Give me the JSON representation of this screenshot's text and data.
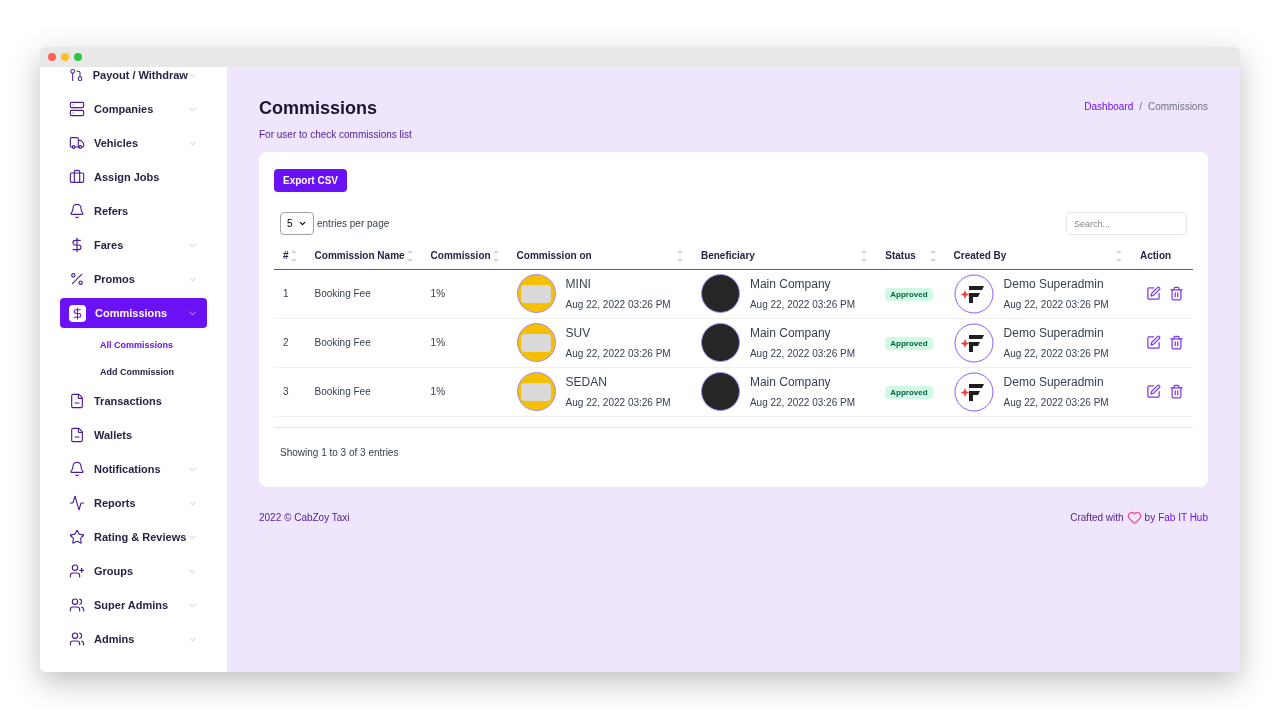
{
  "sidebar": {
    "items": [
      {
        "label": "Payout / Withdraw",
        "expandable": true,
        "selected": false
      },
      {
        "label": "Companies",
        "expandable": true,
        "selected": false
      },
      {
        "label": "Vehicles",
        "expandable": true,
        "selected": false
      },
      {
        "label": "Assign Jobs",
        "expandable": false,
        "selected": false
      },
      {
        "label": "Refers",
        "expandable": false,
        "selected": false
      },
      {
        "label": "Fares",
        "expandable": true,
        "selected": false
      },
      {
        "label": "Promos",
        "expandable": true,
        "selected": false
      },
      {
        "label": "Commissions",
        "expandable": true,
        "selected": true,
        "children": [
          {
            "label": "All Commissions",
            "selected": true
          },
          {
            "label": "Add Commission",
            "selected": false
          }
        ]
      },
      {
        "label": "Transactions",
        "expandable": false,
        "selected": false
      },
      {
        "label": "Wallets",
        "expandable": false,
        "selected": false
      },
      {
        "label": "Notifications",
        "expandable": true,
        "selected": false
      },
      {
        "label": "Reports",
        "expandable": true,
        "selected": false
      },
      {
        "label": "Rating & Reviews",
        "expandable": true,
        "selected": false
      },
      {
        "label": "Groups",
        "expandable": true,
        "selected": false
      },
      {
        "label": "Super Admins",
        "expandable": true,
        "selected": false
      },
      {
        "label": "Admins",
        "expandable": true,
        "selected": false
      }
    ]
  },
  "page": {
    "title": "Commissions",
    "subtitle": "For user to check commissions list",
    "breadcrumb_separator": "/",
    "breadcrumb": [
      {
        "label": "Dashboard",
        "link": true
      },
      {
        "label": "Commissions",
        "link": false
      }
    ]
  },
  "toolbar": {
    "export_button": "Export CSV",
    "page_size": "5",
    "page_size_label": "entries per page",
    "search": {
      "placeholder": "Search..."
    }
  },
  "table": {
    "columns": [
      {
        "label": "#",
        "sortable": true
      },
      {
        "label": "Commission Name",
        "sortable": true
      },
      {
        "label": "Commission",
        "sortable": true
      },
      {
        "label": "Commission on",
        "sortable": true
      },
      {
        "label": "Beneficiary",
        "sortable": true
      },
      {
        "label": "Status",
        "sortable": true
      },
      {
        "label": "Created By",
        "sortable": true
      },
      {
        "label": "Action",
        "sortable": false
      }
    ],
    "rows": [
      {
        "no": "1",
        "name": "Booking Fee",
        "commission": "1%",
        "vehicle": "MINI",
        "vehicle_date": "Aug 22, 2022 03:26 PM",
        "beneficiary": "Main Company",
        "beneficiary_date": "Aug 22, 2022 03:26 PM",
        "status": "Approved",
        "created_by": "Demo Superadmin",
        "created_date": "Aug 22, 2022 03:26 PM"
      },
      {
        "no": "2",
        "name": "Booking Fee",
        "commission": "1%",
        "vehicle": "SUV",
        "vehicle_date": "Aug 22, 2022 03:26 PM",
        "beneficiary": "Main Company",
        "beneficiary_date": "Aug 22, 2022 03:26 PM",
        "status": "Approved",
        "created_by": "Demo Superadmin",
        "created_date": "Aug 22, 2022 03:26 PM"
      },
      {
        "no": "3",
        "name": "Booking Fee",
        "commission": "1%",
        "vehicle": "SEDAN",
        "vehicle_date": "Aug 22, 2022 03:26 PM",
        "beneficiary": "Main Company",
        "beneficiary_date": "Aug 22, 2022 03:26 PM",
        "status": "Approved",
        "created_by": "Demo Superadmin",
        "created_date": "Aug 22, 2022 03:26 PM"
      }
    ],
    "info": "Showing 1 to 3 of 3 entries"
  },
  "footer": {
    "copyright": "2022 © CabZoy Taxi",
    "crafted": "Crafted with",
    "by": "by",
    "author": "Fab IT Hub"
  }
}
